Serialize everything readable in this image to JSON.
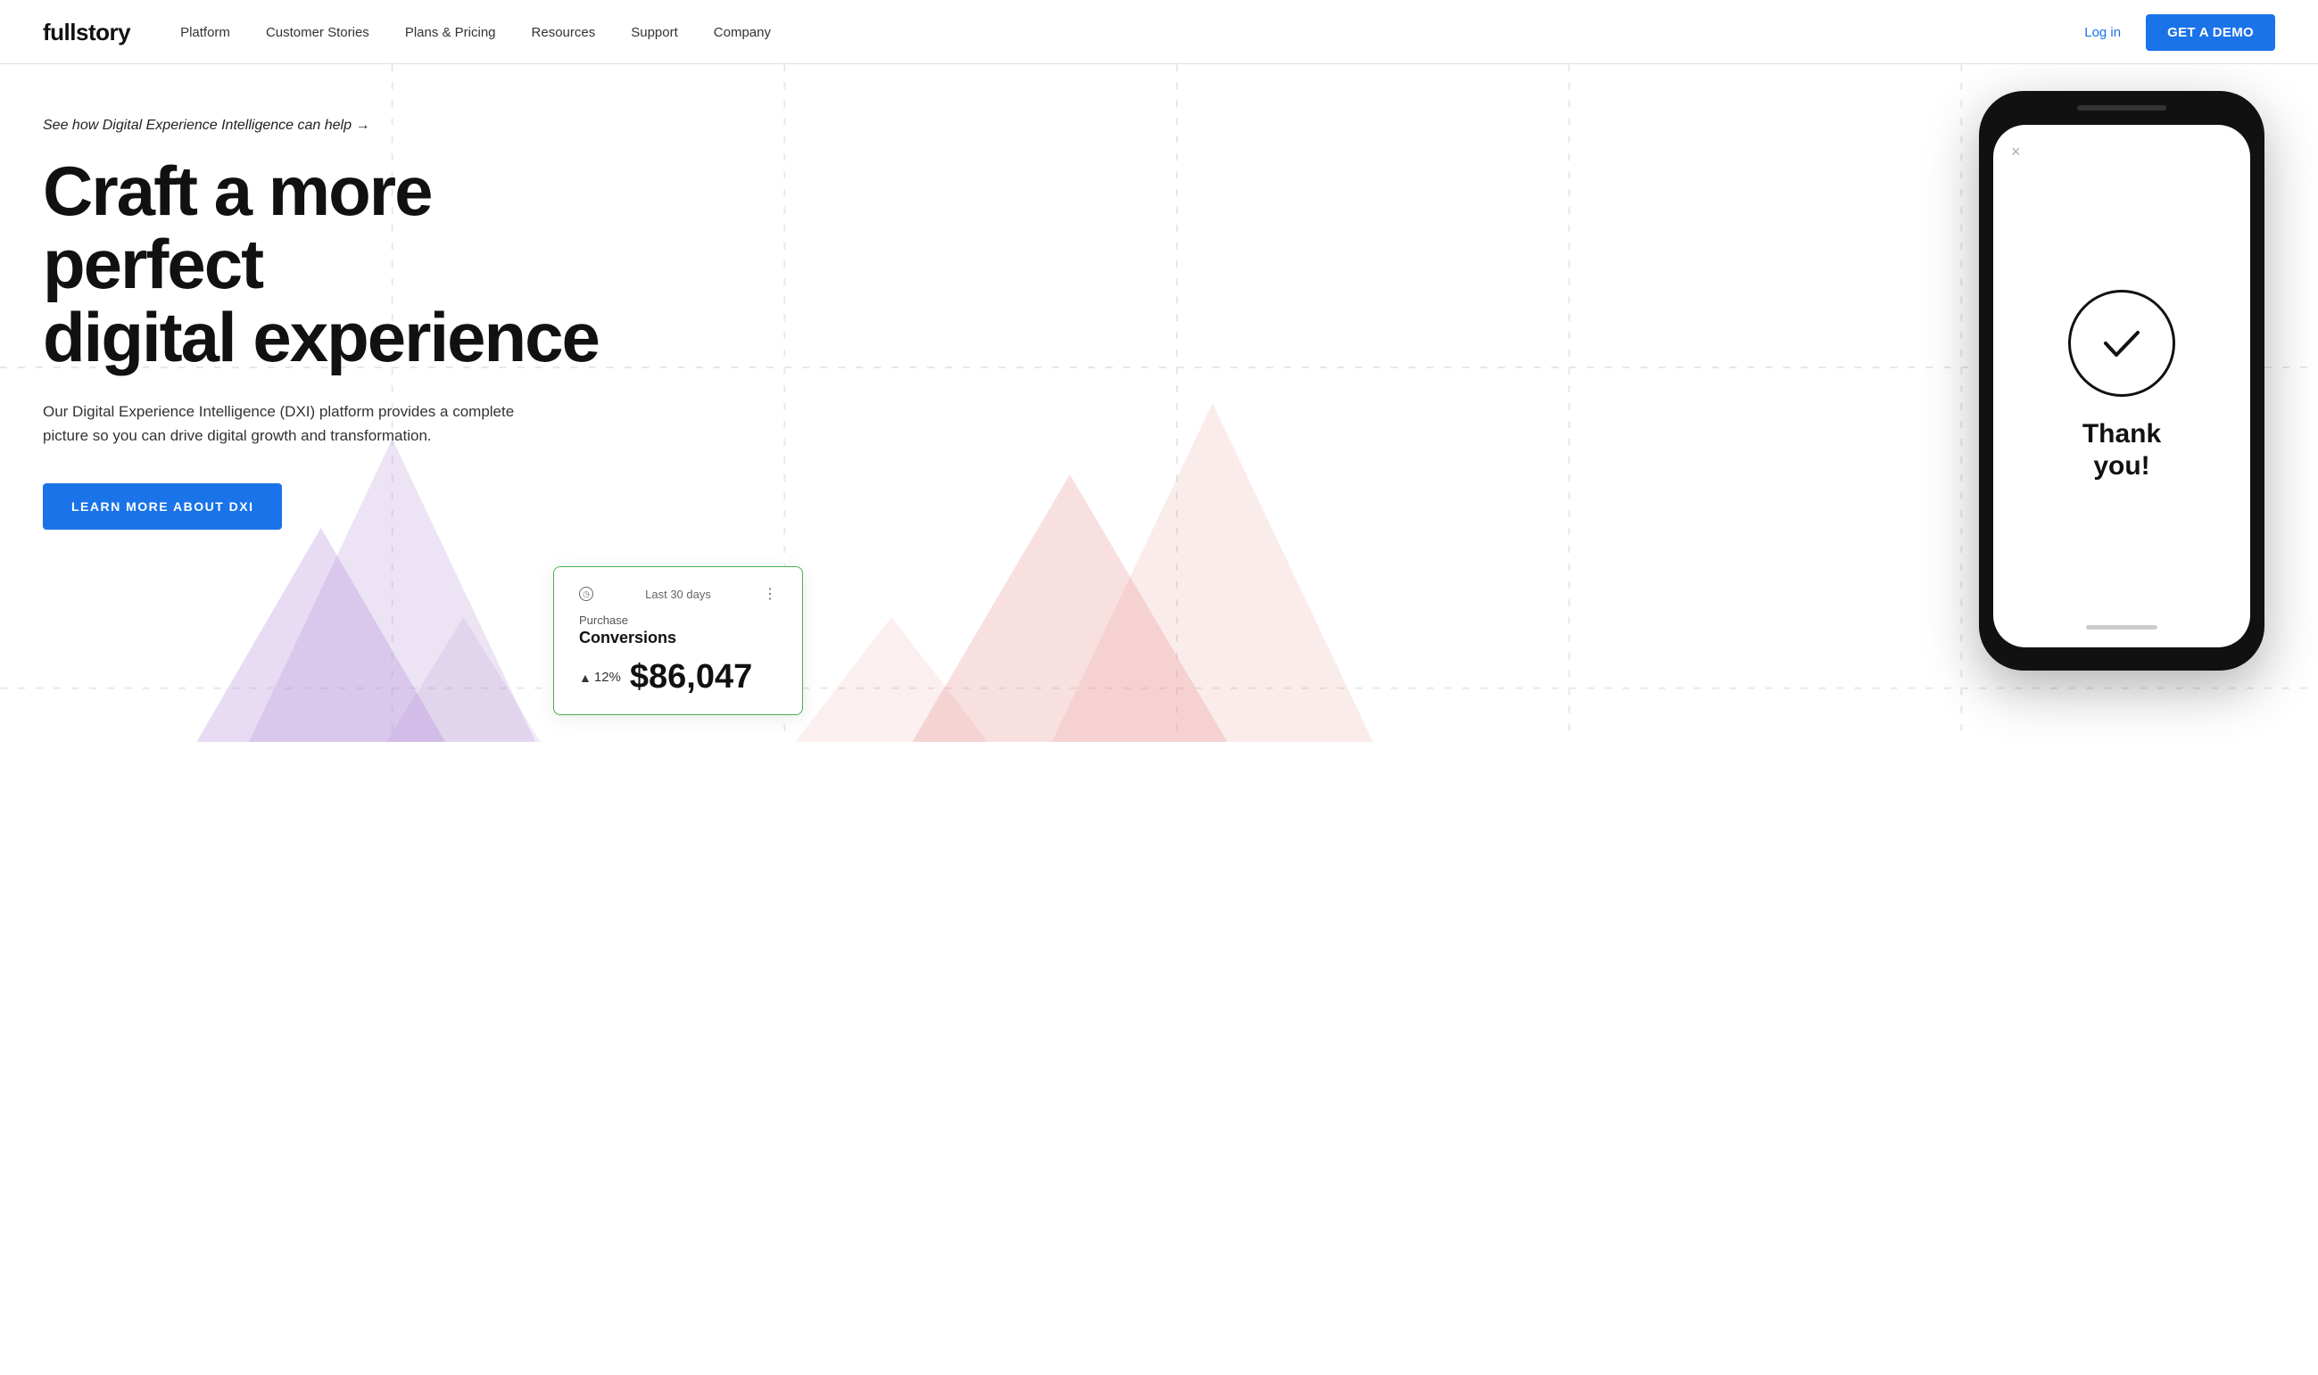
{
  "nav": {
    "logo": "fullstory",
    "links": [
      {
        "label": "Platform",
        "id": "platform"
      },
      {
        "label": "Customer Stories",
        "id": "customer-stories"
      },
      {
        "label": "Plans & Pricing",
        "id": "plans-pricing"
      },
      {
        "label": "Resources",
        "id": "resources"
      },
      {
        "label": "Support",
        "id": "support"
      },
      {
        "label": "Company",
        "id": "company"
      }
    ],
    "login_label": "Log in",
    "demo_label": "GET A DEMO"
  },
  "hero": {
    "tagline": "See how Digital Experience Intelligence can help →",
    "title_line1": "Craft a more perfect",
    "title_line2": "digital experience",
    "subtitle": "Our Digital Experience Intelligence (DXI) platform provides a complete picture so you can drive digital growth and transformation.",
    "cta_label": "LEARN MORE ABOUT DXI"
  },
  "stats_card": {
    "period": "Last 30 days",
    "label": "Purchase",
    "title": "Conversions",
    "percent": "12%",
    "value": "$86,047"
  },
  "phone": {
    "close_label": "×",
    "thank_you_line1": "Thank",
    "thank_you_line2": "you!"
  },
  "colors": {
    "brand_blue": "#1a73e8",
    "text_dark": "#111",
    "accent_green": "#4caf50"
  }
}
